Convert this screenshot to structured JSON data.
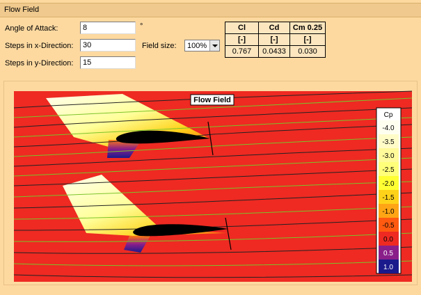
{
  "panel": {
    "title": "Flow Field"
  },
  "inputs": {
    "angle_label": "Angle of Attack:",
    "angle_value": "8",
    "angle_unit": "°",
    "x_steps_label": "Steps in x-Direction:",
    "x_steps_value": "30",
    "y_steps_label": "Steps in y-Direction:",
    "y_steps_value": "15",
    "field_size_label": "Field size:",
    "field_size_value": "100%"
  },
  "coefficients": {
    "headers": [
      "Cl",
      "Cd",
      "Cm 0.25"
    ],
    "units": [
      "[-]",
      "[-]",
      "[-]"
    ],
    "values": [
      "0.767",
      "0.0433",
      "0.030"
    ]
  },
  "plot": {
    "title": "Flow Field",
    "legend_title": "Cp",
    "legend": [
      {
        "label": "-4.0",
        "color": "#fffff0"
      },
      {
        "label": "-3.5",
        "color": "#fffcc8"
      },
      {
        "label": "-3.0",
        "color": "#fffa9a"
      },
      {
        "label": "-2.5",
        "color": "#ffff7a"
      },
      {
        "label": "-2.0",
        "color": "#ffff33"
      },
      {
        "label": "-1.5",
        "color": "#ffd21a"
      },
      {
        "label": "-1.0",
        "color": "#ffa515"
      },
      {
        "label": "-0.5",
        "color": "#ff5a10"
      },
      {
        "label": "0.0",
        "color": "#ee2a22"
      },
      {
        "label": "0.5",
        "color": "#8a1f8a"
      },
      {
        "label": "1.0",
        "color": "#1a1a8c"
      }
    ]
  }
}
